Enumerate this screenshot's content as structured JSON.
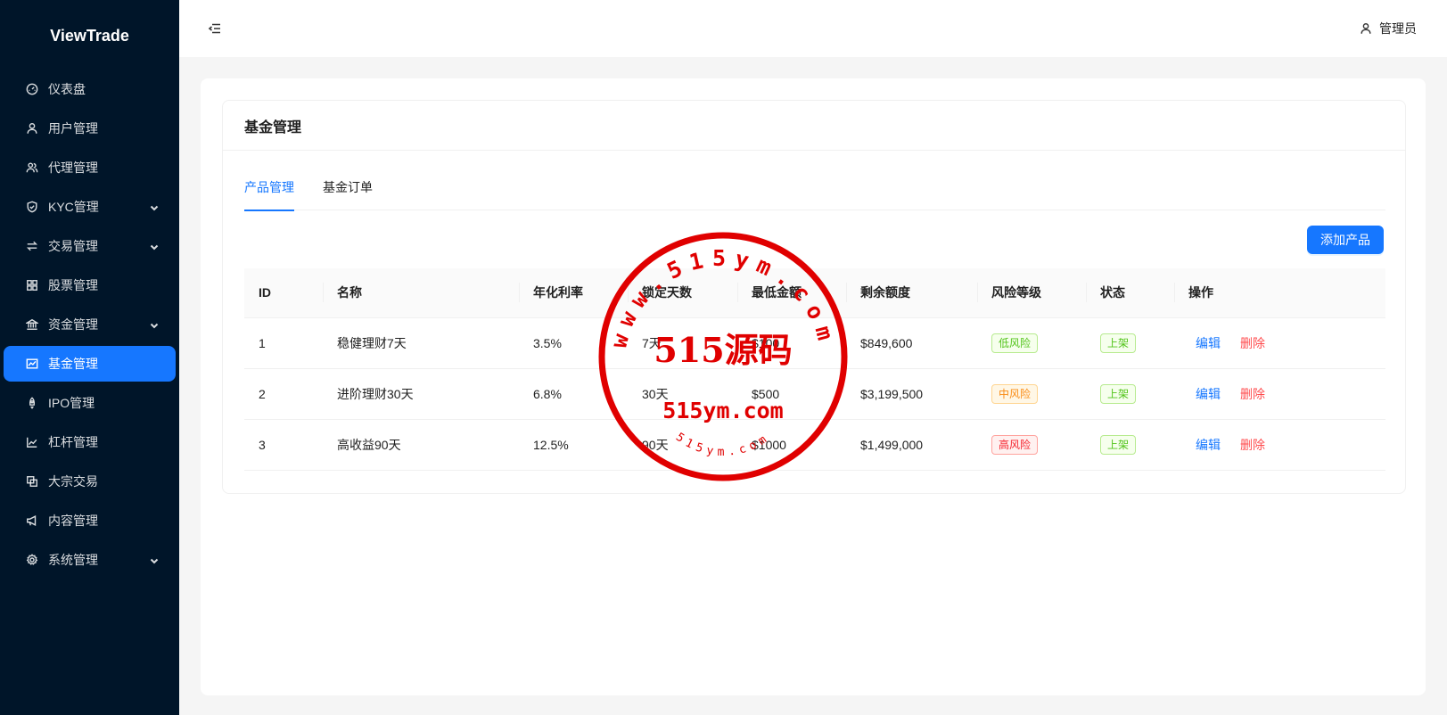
{
  "app": {
    "brand": "ViewTrade"
  },
  "sidebar": {
    "items": [
      {
        "label": "仪表盘",
        "icon": "dashboard-icon",
        "has_children": false,
        "active": false
      },
      {
        "label": "用户管理",
        "icon": "user-icon",
        "has_children": false,
        "active": false
      },
      {
        "label": "代理管理",
        "icon": "team-icon",
        "has_children": false,
        "active": false
      },
      {
        "label": "KYC管理",
        "icon": "shield-icon",
        "has_children": true,
        "active": false
      },
      {
        "label": "交易管理",
        "icon": "swap-icon",
        "has_children": true,
        "active": false
      },
      {
        "label": "股票管理",
        "icon": "grid-icon",
        "has_children": false,
        "active": false
      },
      {
        "label": "资金管理",
        "icon": "bank-icon",
        "has_children": true,
        "active": false
      },
      {
        "label": "基金管理",
        "icon": "fund-icon",
        "has_children": false,
        "active": true
      },
      {
        "label": "IPO管理",
        "icon": "rocket-icon",
        "has_children": false,
        "active": false
      },
      {
        "label": "杠杆管理",
        "icon": "line-chart-icon",
        "has_children": false,
        "active": false
      },
      {
        "label": "大宗交易",
        "icon": "block-icon",
        "has_children": false,
        "active": false
      },
      {
        "label": "内容管理",
        "icon": "notification-icon",
        "has_children": false,
        "active": false
      },
      {
        "label": "系统管理",
        "icon": "setting-icon",
        "has_children": true,
        "active": false
      }
    ]
  },
  "header": {
    "user_label": "管理员"
  },
  "page": {
    "title": "基金管理",
    "tabs": [
      {
        "label": "产品管理",
        "active": true
      },
      {
        "label": "基金订单",
        "active": false
      }
    ],
    "add_button": "添加产品"
  },
  "table": {
    "columns": [
      "ID",
      "名称",
      "年化利率",
      "锁定天数",
      "最低金额",
      "剩余额度",
      "风险等级",
      "状态",
      "操作"
    ],
    "rows": [
      {
        "id": "1",
        "name": "稳健理财7天",
        "rate": "3.5%",
        "days": "7天",
        "min": "$100",
        "remaining": "$849,600",
        "risk": "低风险",
        "risk_color": "#52c41a",
        "status": "上架",
        "edit": "编辑",
        "delete": "删除"
      },
      {
        "id": "2",
        "name": "进阶理财30天",
        "rate": "6.8%",
        "days": "30天",
        "min": "$500",
        "remaining": "$3,199,500",
        "risk": "中风险",
        "risk_color": "#fa8c16",
        "status": "上架",
        "edit": "编辑",
        "delete": "删除"
      },
      {
        "id": "3",
        "name": "高收益90天",
        "rate": "12.5%",
        "days": "90天",
        "min": "$1000",
        "remaining": "$1,499,000",
        "risk": "高风险",
        "risk_color": "#f5222d",
        "status": "上架",
        "edit": "编辑",
        "delete": "删除"
      }
    ]
  },
  "watermark": {
    "ring_text": "www.515ym.com",
    "main": "515源码",
    "sub": "515ym.com",
    "bottom": "515ym.com",
    "color": "#e00000"
  },
  "colors": {
    "primary": "#1677ff",
    "sider_bg": "#001529",
    "danger": "#ff4d4f"
  }
}
